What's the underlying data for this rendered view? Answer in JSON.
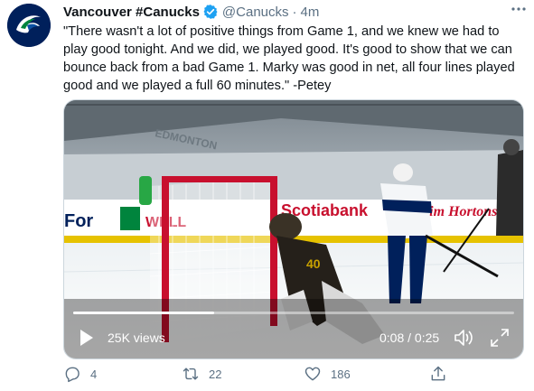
{
  "tweet": {
    "author_name": "Vancouver #Canucks",
    "handle": "@Canucks",
    "separator": "·",
    "time": "4m",
    "text": "\"There wasn't a lot of positive things from Game 1, and we knew we had to play good tonight. And we did, we played good. It's good to show that we can bounce back from a bad Game 1. Marky was good in net, all four lines played good and we played a full 60 minutes.\" -Petey"
  },
  "video": {
    "views": "25K views",
    "timecode": "0:08 / 0:25",
    "progress": 0.32,
    "board_texts": {
      "edmonton": "EDMONTON",
      "for": "For",
      "scotiabank": "Scotiabank",
      "tim_hortons": "Tim Hortons",
      "rink_ad": "WELL",
      "player_number": "40"
    }
  },
  "actions": {
    "reply_count": "4",
    "retweet_count": "22",
    "like_count": "186"
  },
  "colors": {
    "verified": "#1da1f2",
    "canucks_navy": "#00205b",
    "canucks_green": "#00843d",
    "muted": "#5b7083"
  },
  "icons": {
    "reply": "reply-icon",
    "retweet": "retweet-icon",
    "like": "heart-icon",
    "share": "share-icon"
  }
}
